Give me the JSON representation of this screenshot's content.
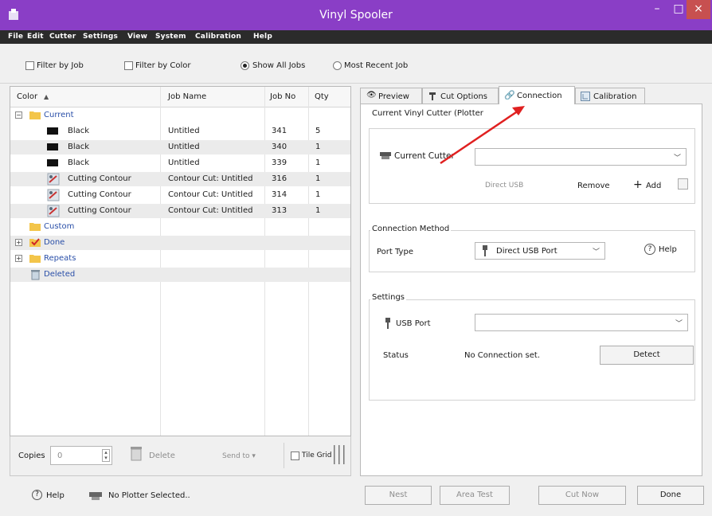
{
  "window": {
    "title": "Vinyl Spooler",
    "minimize": "–",
    "maximize": "□",
    "close": "×"
  },
  "menu": [
    "File",
    "Edit",
    "Cutter",
    "Settings",
    "View",
    "System",
    "Calibration",
    "Help"
  ],
  "filter": {
    "filter_by_job": "Filter by Job",
    "filter_by_color": "Filter by Color",
    "show_all_jobs": "Show All Jobs",
    "most_recent_job": "Most Recent Job",
    "selected": "show_all_jobs"
  },
  "grid": {
    "headers": {
      "color": "Color",
      "sort_indicator": "▲",
      "job_name": "Job Name",
      "job_no": "Job No",
      "qty": "Qty"
    },
    "groups": {
      "current": "Current",
      "custom": "Custom",
      "done": "Done",
      "repeats": "Repeats",
      "deleted": "Deleted"
    },
    "rows": [
      {
        "color": "Black",
        "job_name": "Untitled",
        "job_no": "341",
        "qty": "5"
      },
      {
        "color": "Black",
        "job_name": "Untitled",
        "job_no": "340",
        "qty": "1"
      },
      {
        "color": "Black",
        "job_name": "Untitled",
        "job_no": "339",
        "qty": "1"
      },
      {
        "color": "Cutting Contour",
        "job_name": "Contour Cut: Untitled",
        "job_no": "316",
        "qty": "1"
      },
      {
        "color": "Cutting Contour",
        "job_name": "Contour Cut: Untitled",
        "job_no": "314",
        "qty": "1"
      },
      {
        "color": "Cutting Contour",
        "job_name": "Contour Cut: Untitled",
        "job_no": "313",
        "qty": "1"
      }
    ]
  },
  "copies_bar": {
    "copies_label": "Copies",
    "copies_value": "0",
    "delete": "Delete",
    "send_to": "Send to ▾",
    "tile_grid": "Tile Grid"
  },
  "tabs": {
    "preview": "Preview",
    "cut_options": "Cut Options",
    "connection": "Connection",
    "calibration": "Calibration",
    "active": "connection"
  },
  "connection": {
    "current_cutter_group": "Current Vinyl Cutter (Plotter",
    "current_cutter_label": "Current Cutter",
    "current_cutter_value": "",
    "direct_usb": "Direct USB",
    "remove": "Remove",
    "add": "Add",
    "method_group": "Connection Method",
    "port_type_label": "Port Type",
    "port_type_value": "Direct USB Port",
    "help": "Help",
    "settings_group": "Settings",
    "usb_port_label": "USB Port",
    "usb_port_value": "",
    "status_label": "Status",
    "status_value": "No Connection set.",
    "detect": "Detect"
  },
  "footer": {
    "help": "Help",
    "plotter_status": "No Plotter Selected..",
    "nest": "Nest",
    "area_test": "Area Test",
    "cut_now": "Cut Now",
    "done": "Done"
  },
  "colors": {
    "titlebar": "#8a3ec6",
    "menubar": "#2b2b2b",
    "group_text": "#2a4fa8",
    "arrow": "#e02020"
  }
}
